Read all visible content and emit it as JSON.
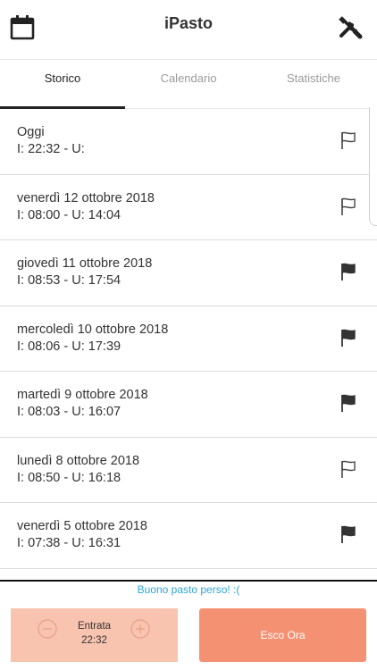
{
  "header": {
    "title": "iPasto",
    "calendar_icon": "calendar-icon",
    "tools_icon": "tools-icon"
  },
  "tabs": [
    {
      "label": "Storico",
      "active": true
    },
    {
      "label": "Calendario",
      "active": false
    },
    {
      "label": "Statistiche",
      "active": false
    }
  ],
  "entries": [
    {
      "date": "Oggi",
      "times": "I: 22:32 - U:",
      "flag": "outline"
    },
    {
      "date": "venerdì 12 ottobre 2018",
      "times": "I: 08:00 - U: 14:04",
      "flag": "outline"
    },
    {
      "date": "giovedì 11 ottobre 2018",
      "times": "I: 08:53 - U: 17:54",
      "flag": "filled"
    },
    {
      "date": "mercoledì 10 ottobre 2018",
      "times": "I: 08:06 - U: 17:39",
      "flag": "filled"
    },
    {
      "date": "martedì 9 ottobre 2018",
      "times": "I: 08:03 - U: 16:07",
      "flag": "filled"
    },
    {
      "date": "lunedì 8 ottobre 2018",
      "times": "I: 08:50 - U: 16:18",
      "flag": "outline"
    },
    {
      "date": "venerdì 5 ottobre 2018",
      "times": "I: 07:38 - U: 16:31",
      "flag": "filled"
    }
  ],
  "footer": {
    "status_message": "Buono pasto perso! :(",
    "entrata_label": "Entrata",
    "entrata_time": "22:32",
    "exit_button": "Esco Ora"
  },
  "colors": {
    "accent": "#f59173",
    "entrata_bg": "#f8c4b0",
    "message": "#2ea6d8"
  }
}
